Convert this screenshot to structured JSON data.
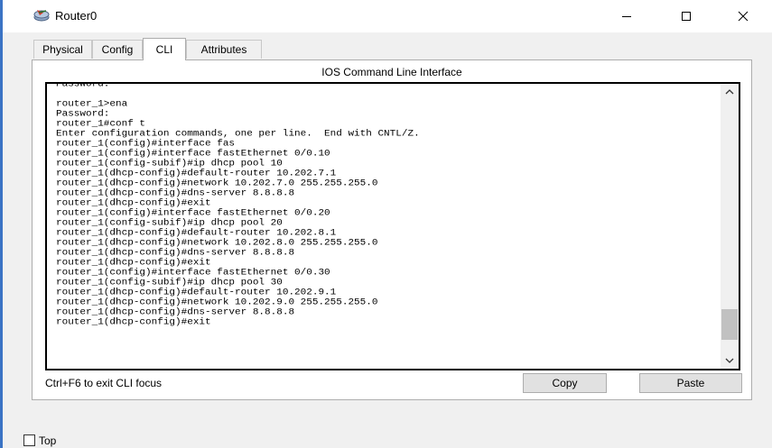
{
  "window": {
    "title": "Router0",
    "icon": "router-icon",
    "controls": [
      "minimize-icon",
      "maximize-icon",
      "close-icon"
    ]
  },
  "tabs": [
    {
      "label": "Physical",
      "active": false
    },
    {
      "label": "Config",
      "active": false
    },
    {
      "label": "CLI",
      "active": true
    },
    {
      "label": "Attributes",
      "active": false
    }
  ],
  "cli": {
    "heading": "IOS Command Line Interface",
    "lines": [
      "Password:",
      "",
      "router_1>ena",
      "Password:",
      "router_1#conf t",
      "Enter configuration commands, one per line.  End with CNTL/Z.",
      "router_1(config)#interface fas",
      "router_1(config)#interface fastEthernet 0/0.10",
      "router_1(config-subif)#ip dhcp pool 10",
      "router_1(dhcp-config)#default-router 10.202.7.1",
      "router_1(dhcp-config)#network 10.202.7.0 255.255.255.0",
      "router_1(dhcp-config)#dns-server 8.8.8.8",
      "router_1(dhcp-config)#exit",
      "router_1(config)#interface fastEthernet 0/0.20",
      "router_1(config-subif)#ip dhcp pool 20",
      "router_1(dhcp-config)#default-router 10.202.8.1",
      "router_1(dhcp-config)#network 10.202.8.0 255.255.255.0",
      "router_1(dhcp-config)#dns-server 8.8.8.8",
      "router_1(dhcp-config)#exit",
      "router_1(config)#interface fastEthernet 0/0.30",
      "router_1(config-subif)#ip dhcp pool 30",
      "router_1(dhcp-config)#default-router 10.202.9.1",
      "router_1(dhcp-config)#network 10.202.9.0 255.255.255.0",
      "router_1(dhcp-config)#dns-server 8.8.8.8",
      "router_1(dhcp-config)#exit"
    ],
    "scroll_position": 0.88
  },
  "footer": {
    "hint": "Ctrl+F6 to exit CLI focus",
    "copy_label": "Copy",
    "paste_label": "Paste"
  },
  "top_option": {
    "label": "Top",
    "checked": false
  }
}
